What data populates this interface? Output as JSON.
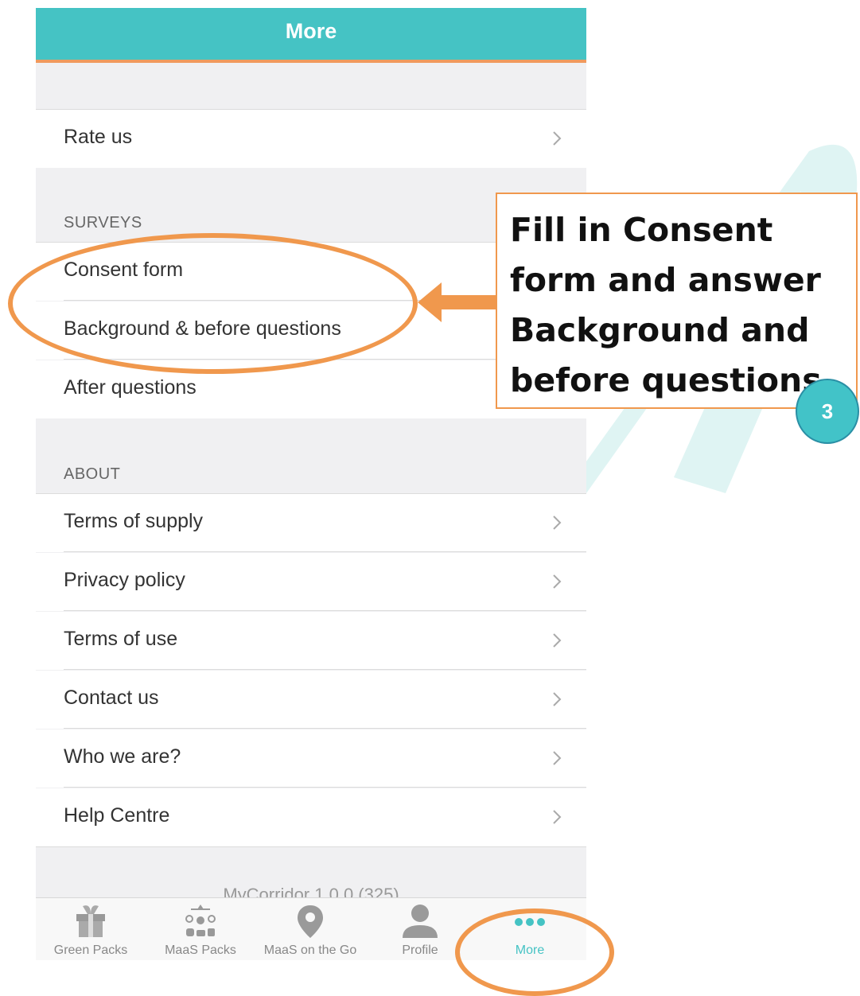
{
  "header": {
    "title": "More"
  },
  "rows_top": [
    {
      "label": "Rate us"
    }
  ],
  "surveys": {
    "section_label": "SURVEYS",
    "items": [
      {
        "label": "Consent form"
      },
      {
        "label": "Background & before questions"
      },
      {
        "label": "After questions"
      }
    ]
  },
  "about": {
    "section_label": "ABOUT",
    "items": [
      {
        "label": "Terms of supply"
      },
      {
        "label": "Privacy policy"
      },
      {
        "label": "Terms of use"
      },
      {
        "label": "Contact us"
      },
      {
        "label": "Who we are?"
      },
      {
        "label": "Help Centre"
      }
    ]
  },
  "version_text": "MyCorridor 1.0.0 (325)",
  "tabbar": {
    "tabs": [
      {
        "label": "Green Packs",
        "icon": "gift-icon"
      },
      {
        "label": "MaaS Packs",
        "icon": "transport-modes-icon"
      },
      {
        "label": "MaaS on the Go",
        "icon": "location-pin-icon"
      },
      {
        "label": "Profile",
        "icon": "person-icon"
      },
      {
        "label": "More",
        "icon": "more-dots-icon",
        "active": true
      }
    ]
  },
  "callout": {
    "text": "Fill in Consent form and answer Background and before questions",
    "step": "3"
  },
  "colors": {
    "header": "#45c3c4",
    "accent_orange": "#f0984d",
    "badge": "#42c3c8",
    "tab_active": "#45c3c4",
    "background": "#f0f0f2"
  }
}
